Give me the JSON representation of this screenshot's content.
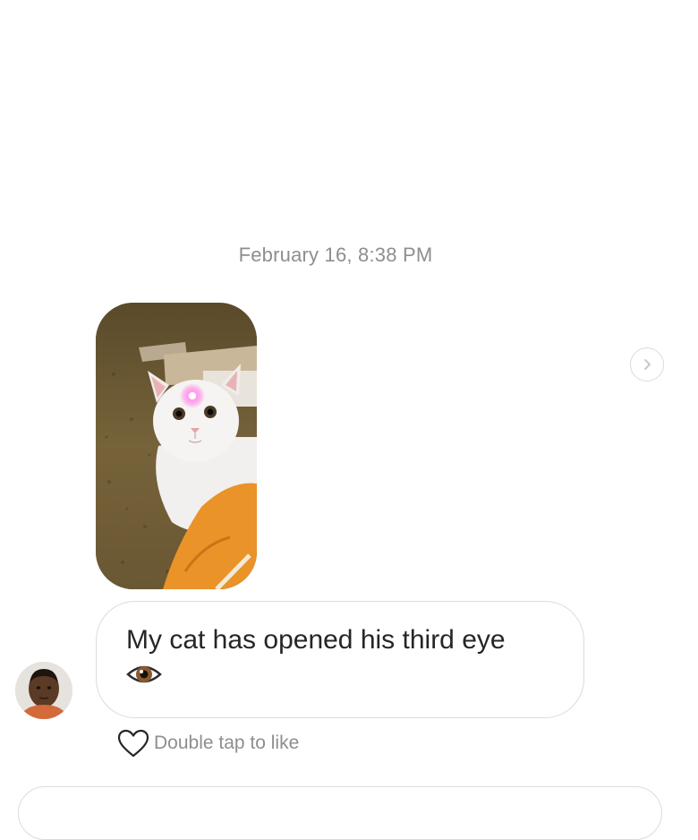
{
  "thread": {
    "timestamp": "February 16, 8:38 PM"
  },
  "message_photo": {
    "icon": "cat-photo-image"
  },
  "forward": {
    "icon": "chevron-right-icon"
  },
  "message_text": {
    "text": "My cat has opened his third eye",
    "emoji": "eye-emoji"
  },
  "sender": {
    "icon": "avatar-image"
  },
  "like": {
    "icon": "heart-icon",
    "label": "Double tap to like"
  },
  "colors": {
    "secondary_text": "#8e8e8e",
    "bubble_border": "#dbdbdb",
    "primary_text": "#262626"
  }
}
